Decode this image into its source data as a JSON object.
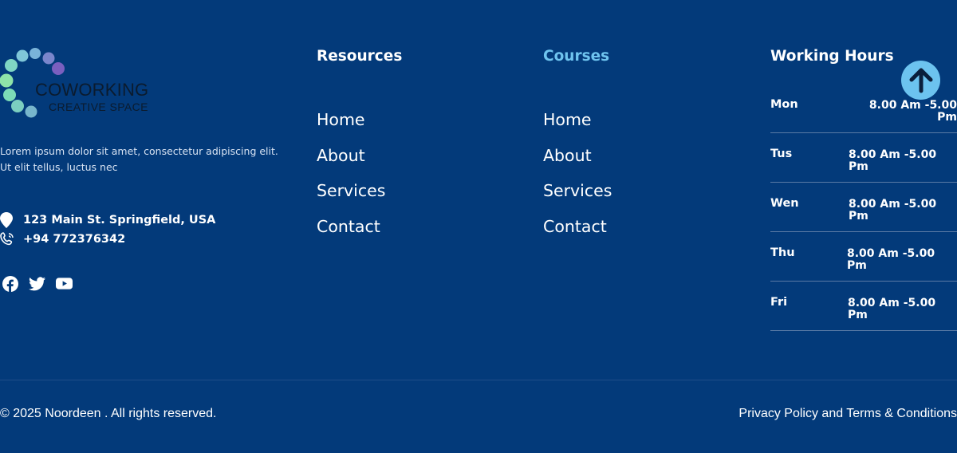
{
  "brand": {
    "title": "COWORKING",
    "subtitle": "CREATIVE SPACE",
    "description": "Lorem ipsum dolor sit amet, consectetur adipiscing elit. Ut elit tellus, luctus nec"
  },
  "contact": {
    "address": "123 Main St. Springfield, USA",
    "phone": "+94 772376342",
    "address_icon": "map-pin-icon",
    "phone_icon": "phone-icon"
  },
  "socials": [
    "facebook-icon",
    "twitter-icon",
    "youtube-icon"
  ],
  "resources": {
    "title": "Resources",
    "links": [
      "Home",
      "About",
      "Services",
      "Contact"
    ]
  },
  "courses": {
    "title": "Courses",
    "links": [
      "Home",
      "About",
      "Services",
      "Contact"
    ]
  },
  "hours": {
    "title": "Working Hours",
    "rows": [
      {
        "day": "Mon",
        "time": "8.00 Am -5.00 Pm"
      },
      {
        "day": "Tus",
        "time": "8.00 Am -5.00 Pm"
      },
      {
        "day": "Wen",
        "time": "8.00 Am -5.00 Pm"
      },
      {
        "day": "Thu",
        "time": "8.00 Am -5.00 Pm"
      },
      {
        "day": "Fri",
        "time": "8.00 Am -5.00 Pm"
      }
    ]
  },
  "footer": {
    "copyright": "© 2025 Noordeen . All rights reserved.",
    "legal": "Privacy Policy and Terms & Conditions"
  },
  "colors": {
    "background": "#033a7a",
    "accent": "#6fc4ef",
    "scroll_button": "#6cc3ef"
  }
}
